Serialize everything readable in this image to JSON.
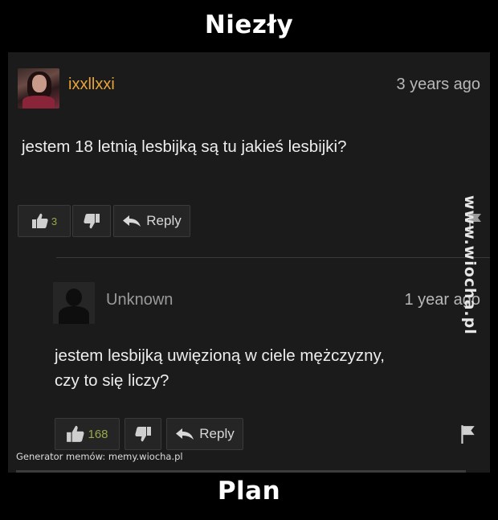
{
  "meme": {
    "top_title": "Niezły",
    "bottom_title": "Plan",
    "watermark": "www.wiocha.pl",
    "generator_credit": "Generator memów:  memy.wiocha.pl"
  },
  "comments": [
    {
      "username": "ixxllxxi",
      "time": "3 years ago",
      "text": "jestem 18 letnią lesbijką są tu jakieś lesbijki?",
      "likes": "3",
      "reply_label": "Reply",
      "avatar": "profile-photo"
    },
    {
      "username": "Unknown",
      "time": "1 year ago",
      "text": "jestem lesbijką uwięzioną w ciele mężczyzny, czy to się liczy?",
      "likes": "168",
      "reply_label": "Reply",
      "avatar": "default-user-silhouette"
    }
  ],
  "icons": {
    "like": "thumbs-up-icon",
    "dislike": "thumbs-down-icon",
    "reply": "reply-arrow-icon",
    "flag": "flag-icon"
  },
  "colors": {
    "background": "#000000",
    "panel": "#1b1b1b",
    "username_highlight": "#e8a33a",
    "like_count": "#9aa84a"
  }
}
